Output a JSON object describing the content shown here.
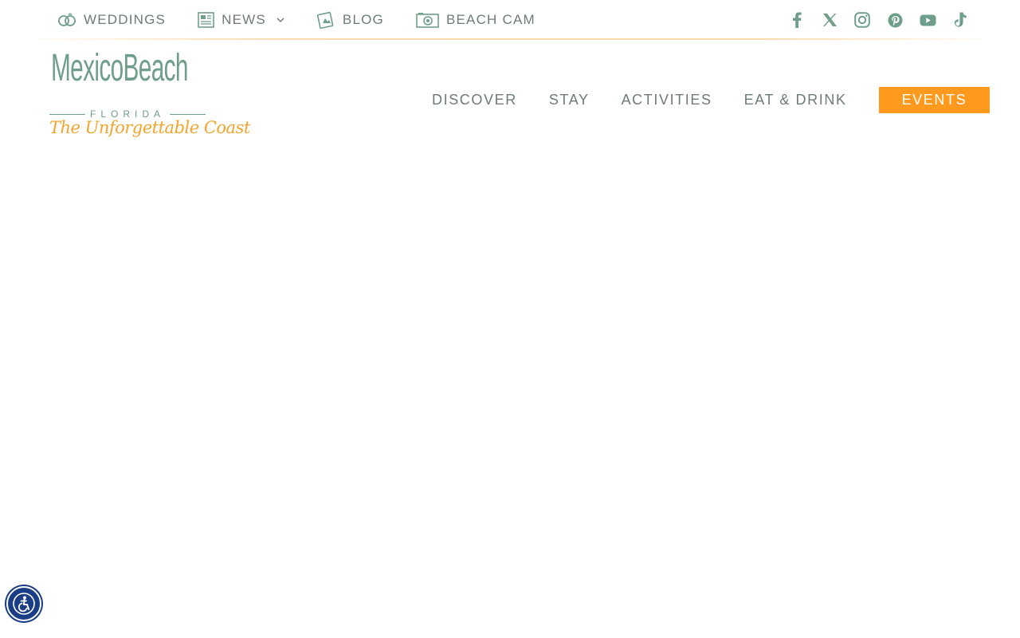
{
  "utility_nav": [
    {
      "label": "WEDDINGS",
      "icon": "rings-icon"
    },
    {
      "label": "NEWS",
      "icon": "newspaper-icon",
      "dropdown": true
    },
    {
      "label": "BLOG",
      "icon": "blog-icon"
    },
    {
      "label": "BEACH CAM",
      "icon": "camera-icon"
    }
  ],
  "social": [
    "facebook-icon",
    "x-icon",
    "instagram-icon",
    "pinterest-icon",
    "youtube-icon",
    "tiktok-icon"
  ],
  "logo": {
    "wordmark": "MexicoBeach",
    "sub": "FLORIDA",
    "tagline": "The Unforgettable Coast"
  },
  "main_nav": [
    "DISCOVER",
    "STAY",
    "ACTIVITIES",
    "EAT & DRINK",
    "EVENTS"
  ],
  "colors": {
    "accent": "#ff9a1f",
    "brand_green": "#6f9e8a",
    "nav_text": "#6f7a7a",
    "a11y_blue": "#1a3d86"
  }
}
